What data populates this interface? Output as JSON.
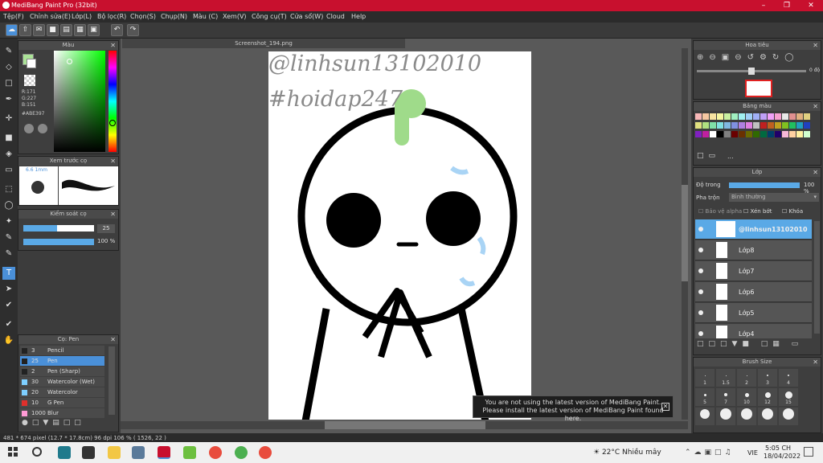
{
  "app": {
    "title": "MediBang Paint Pro (32bit)",
    "document_tab": "Screenshot_194.png"
  },
  "menu": [
    "Tệp(F)",
    "Chỉnh sửa(E)",
    "Lớp(L)",
    "Bộ lọc(R)",
    "Chọn(S)",
    "Chụp(N)",
    "Màu (C)",
    "Xem(V)",
    "Công cụ(T)",
    "Cửa sổ(W)",
    "Cloud",
    "Help"
  ],
  "color_panel": {
    "title": "Màu",
    "r": "R:171",
    "g": "G:227",
    "b": "B:151",
    "hex": "#ABE397",
    "fg_color": "#ABE397",
    "bg_color": "#ffffff"
  },
  "brush_preview": {
    "title": "Xem trước cọ",
    "size": "6.6 1mm"
  },
  "brush_control": {
    "title": "Kiểm soát cọ",
    "size": "25",
    "opacity": "100 %"
  },
  "brush_list": {
    "title": "Cọ: Pen",
    "items": [
      {
        "size": "3",
        "name": "Pencil",
        "color": "#222222"
      },
      {
        "size": "25",
        "name": "Pen",
        "color": "#222222",
        "selected": true
      },
      {
        "size": "2",
        "name": "Pen (Sharp)",
        "color": "#222222"
      },
      {
        "size": "30",
        "name": "Watercolor (Wet)",
        "color": "#7ecfff"
      },
      {
        "size": "20",
        "name": "Watercolor",
        "color": "#7ecfff"
      },
      {
        "size": "10",
        "name": "G Pen",
        "color": "#e0302c"
      },
      {
        "size": "1000",
        "name": "Blur",
        "color": "#ff9ad5"
      }
    ]
  },
  "canvas": {
    "text1": "@linhsun13102010",
    "text2": "#hoidap247"
  },
  "notice": {
    "line1": "You are not using the latest version of MediBang Paint.",
    "line2": "Please install the latest version of MediBang Paint found here."
  },
  "navigator": {
    "title": "Hoa tiêu",
    "angle": "0 độ"
  },
  "palette": {
    "title": "Bảng màu",
    "more": "..."
  },
  "layer_panel": {
    "title": "Lớp",
    "opacity_label": "Độ trong",
    "opacity_value": "100 %",
    "blend_label": "Pha trộn",
    "blend_value": "Bình thường",
    "protect_alpha": "Bảo vệ alpha",
    "clipping": "Xén bớt",
    "lock": "Khóa",
    "layers": [
      "@linhsun13102010",
      "Lớp8",
      "Lớp7",
      "Lớp6",
      "Lớp5",
      "Lớp4"
    ]
  },
  "brush_size": {
    "title": "Brush Size",
    "labels": [
      "1",
      "1.5",
      "2",
      "3",
      "4",
      "5",
      "7",
      "10",
      "12",
      "15"
    ]
  },
  "status": {
    "text": "481 * 674 pixel  (12.7 * 17.8cm)  96 dpi  106 %  ( 1526, 22 )"
  },
  "taskbar": {
    "weather": "22°C  Nhiều mây",
    "lang": "VIE",
    "time": "5:05 CH",
    "date": "18/04/2022"
  }
}
